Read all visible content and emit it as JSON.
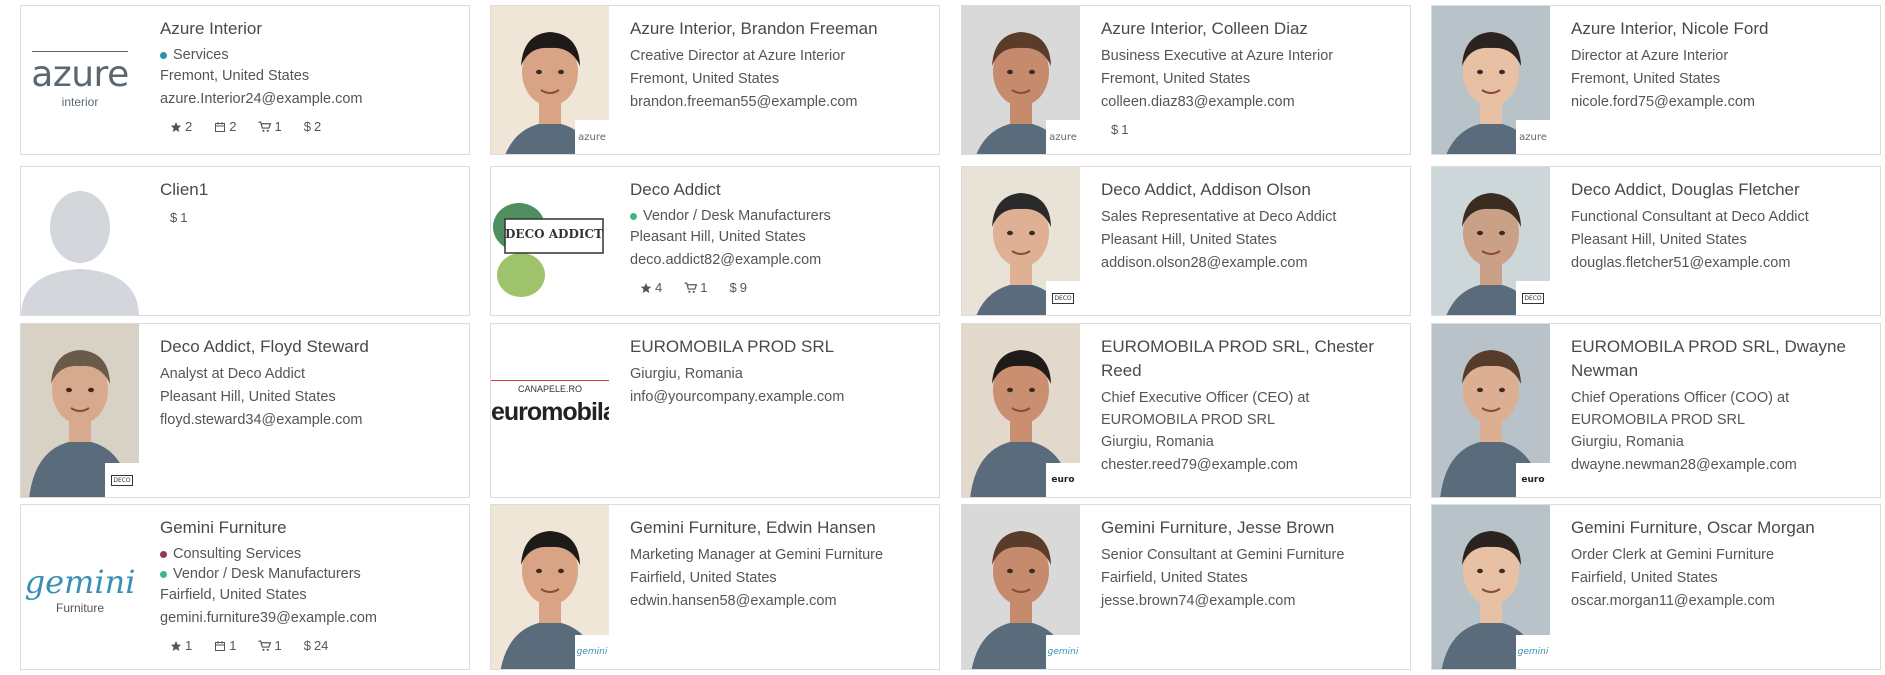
{
  "colors": {
    "services": "#2e8fa8",
    "vendor": "#3bb980",
    "consulting": "#8b3a62",
    "border": "#dcdcdc"
  },
  "icons": {
    "star": "star-icon",
    "calendar": "calendar-icon",
    "cart": "cart-icon",
    "dollar": "dollar-icon"
  },
  "cards": [
    {
      "name": "Azure Interior",
      "categories": [
        {
          "label": "Services",
          "color": "#2e8fa8"
        }
      ],
      "lines": [
        "Fremont, United States",
        "azure.Interior24@example.com"
      ],
      "stats": {
        "star": "2",
        "cal": "2",
        "cart": "1",
        "dollar": "2"
      },
      "logo": "azure",
      "logo_big": "azure",
      "logo_small": "interior"
    },
    {
      "name": "Azure Interior, Brandon Freeman",
      "lines": [
        "Creative Director at Azure Interior",
        "Fremont, United States",
        "brandon.freeman55@example.com"
      ],
      "mini": "azure"
    },
    {
      "name": "Azure Interior, Colleen Diaz",
      "lines": [
        "Business Executive at Azure Interior",
        "Fremont, United States",
        "colleen.diaz83@example.com"
      ],
      "stats": {
        "dollar": "1"
      },
      "mini": "azure"
    },
    {
      "name": "Azure Interior, Nicole Ford",
      "lines": [
        "Director at Azure Interior",
        "Fremont, United States",
        "nicole.ford75@example.com"
      ],
      "mini": "azure"
    },
    {
      "name": "Clien1",
      "stats": {
        "dollar": "1"
      },
      "placeholder": true
    },
    {
      "name": "Deco Addict",
      "categories": [
        {
          "label": "Vendor / Desk Manufacturers",
          "color": "#3bb980"
        }
      ],
      "lines": [
        "Pleasant Hill, United States",
        "deco.addict82@example.com"
      ],
      "stats": {
        "star": "4",
        "cart": "1",
        "dollar": "9"
      },
      "logo": "deco",
      "logo_text": "DECO ADDICT"
    },
    {
      "name": "Deco Addict, Addison Olson",
      "lines": [
        "Sales Representative at Deco Addict",
        "Pleasant Hill, United States",
        "addison.olson28@example.com"
      ],
      "mini": "deco"
    },
    {
      "name": "Deco Addict, Douglas Fletcher",
      "lines": [
        "Functional Consultant at Deco Addict",
        "Pleasant Hill, United States",
        "douglas.fletcher51@example.com"
      ],
      "mini": "deco"
    },
    {
      "name": "Deco Addict, Floyd Steward",
      "lines": [
        "Analyst at Deco Addict",
        "Pleasant Hill, United States",
        "floyd.steward34@example.com"
      ],
      "mini": "deco"
    },
    {
      "name": "EUROMOBILA PROD SRL",
      "lines": [
        "Giurgiu, Romania",
        "info@yourcompany.example.com"
      ],
      "logo": "euro",
      "logo_top": "CANAPELE.RO",
      "logo_text": "euromobila"
    },
    {
      "name": "EUROMOBILA PROD SRL, Chester Reed",
      "lines": [
        "Chief Executive Officer (CEO) at EUROMOBILA PROD SRL",
        "Giurgiu, Romania",
        "chester.reed79@example.com"
      ],
      "mini": "euro"
    },
    {
      "name": "EUROMOBILA PROD SRL, Dwayne Newman",
      "lines": [
        "Chief Operations Officer (COO) at EUROMOBILA PROD SRL",
        "Giurgiu, Romania",
        "dwayne.newman28@example.com"
      ],
      "mini": "euro"
    },
    {
      "name": "Gemini Furniture",
      "categories": [
        {
          "label": "Consulting Services",
          "color": "#8b3a62"
        },
        {
          "label": "Vendor / Desk Manufacturers",
          "color": "#3bb980"
        }
      ],
      "lines": [
        "Fairfield, United States",
        "gemini.furniture39@example.com"
      ],
      "stats": {
        "star": "1",
        "cal": "1",
        "cart": "1",
        "dollar": "24"
      },
      "logo": "gemini",
      "logo_text": "gemini",
      "logo_small": "Furniture"
    },
    {
      "name": "Gemini Furniture, Edwin Hansen",
      "lines": [
        "Marketing Manager at Gemini Furniture",
        "Fairfield, United States",
        "edwin.hansen58@example.com"
      ],
      "mini": "gemini"
    },
    {
      "name": "Gemini Furniture, Jesse Brown",
      "lines": [
        "Senior Consultant at Gemini Furniture",
        "Fairfield, United States",
        "jesse.brown74@example.com"
      ],
      "mini": "gemini"
    },
    {
      "name": "Gemini Furniture, Oscar Morgan",
      "lines": [
        "Order Clerk at Gemini Furniture",
        "Fairfield, United States",
        "oscar.morgan11@example.com"
      ],
      "mini": "gemini"
    }
  ]
}
